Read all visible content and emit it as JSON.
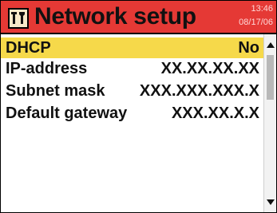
{
  "header": {
    "title": "Network setup",
    "time": "13:46",
    "date": "08/17/06",
    "icon": "settings-tools-icon",
    "color": "#e53935"
  },
  "settings": [
    {
      "label": "DHCP",
      "value": "No",
      "selected": true
    },
    {
      "label": "IP-address",
      "value": "XX.XX.XX.XX"
    },
    {
      "label": "Subnet mask",
      "value": "XXX.XXX.XXX.X"
    },
    {
      "label": "Default gateway",
      "value": "XXX.XX.X.X"
    }
  ],
  "colors": {
    "selection": "#f6d94a",
    "scroll_track": "#f2f2f2",
    "scroll_thumb": "#b8b8b8"
  }
}
